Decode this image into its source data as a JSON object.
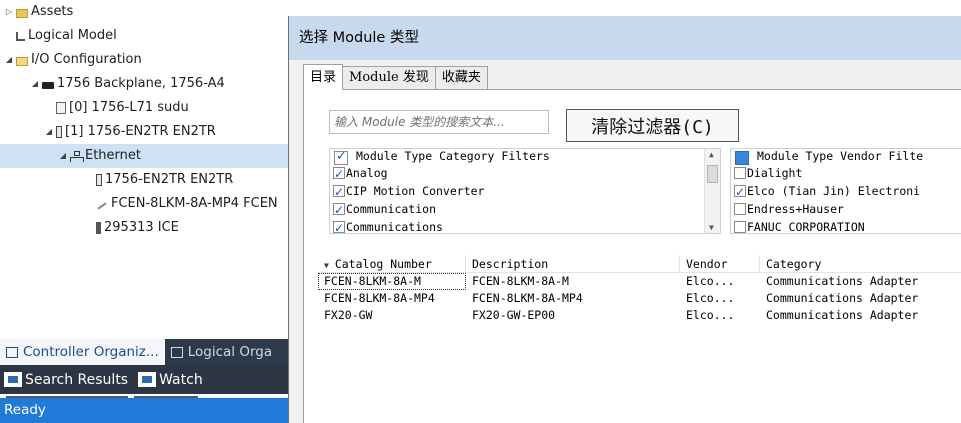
{
  "organizer": {
    "tree": [
      {
        "label": "Assets",
        "icon": "folder-icon",
        "expand": "▷",
        "indent": 1
      },
      {
        "label": "Logical Model",
        "icon": "logical-model-icon",
        "expand": "",
        "indent": 1
      },
      {
        "label": "I/O Configuration",
        "icon": "folder-open-icon",
        "expand": "◢",
        "indent": 1
      },
      {
        "label": "1756 Backplane, 1756-A4",
        "icon": "backplane-icon",
        "expand": "◢",
        "indent": 2
      },
      {
        "label": "[0] 1756-L71 sudu",
        "icon": "controller-icon",
        "expand": "",
        "indent": 3
      },
      {
        "label": "[1] 1756-EN2TR EN2TR",
        "icon": "module-icon",
        "expand": "◢",
        "indent": 3
      },
      {
        "label": "Ethernet",
        "icon": "ethernet-icon",
        "expand": "◢",
        "indent": 4,
        "selected": true
      },
      {
        "label": "1756-EN2TR EN2TR",
        "icon": "module-icon",
        "expand": "",
        "indent": 5
      },
      {
        "label": "FCEN-8LKM-8A-MP4 FCEN",
        "icon": "cable-icon",
        "expand": "",
        "indent": 5
      },
      {
        "label": "295313 ICE",
        "icon": "device-icon",
        "expand": "",
        "indent": 5
      }
    ],
    "tabs": [
      "Controller Organiz...",
      "Logical Orga"
    ],
    "bottom_buttons": [
      "Search Results",
      "Watch"
    ],
    "status": "Ready"
  },
  "dialog": {
    "title": "选择 Module 类型",
    "tabs": [
      "目录",
      "Module 发现",
      "收藏夹"
    ],
    "search_placeholder": "输入 Module 类型的搜索文本...",
    "clear_filter_label": "清除过滤器(C)",
    "category_filters": {
      "header": "Module Type Category Filters",
      "items": [
        {
          "label": "Analog",
          "checked": true
        },
        {
          "label": "CIP Motion Converter",
          "checked": true
        },
        {
          "label": "Communication",
          "checked": true
        },
        {
          "label": "Communications",
          "checked": true
        }
      ]
    },
    "vendor_filters": {
      "header": "Module Type Vendor Filte",
      "items": [
        {
          "label": "Dialight",
          "checked": false
        },
        {
          "label": "Elco (Tian Jin) Electroni",
          "checked": true
        },
        {
          "label": "Endress+Hauser",
          "checked": false
        },
        {
          "label": "FANUC CORPORATION",
          "checked": false
        }
      ]
    },
    "table": {
      "columns": [
        "Catalog Number",
        "Description",
        "Vendor",
        "Category"
      ],
      "rows": [
        [
          "FCEN-8LKM-8A-M",
          "FCEN-8LKM-8A-M",
          "Elco...",
          "Communications Adapter"
        ],
        [
          "FCEN-8LKM-8A-MP4",
          "FCEN-8LKM-8A-MP4",
          "Elco...",
          "Communications Adapter"
        ],
        [
          "FX20-GW",
          "FX20-GW-EP00",
          "Elco...",
          "Communications Adapter"
        ]
      ]
    }
  },
  "colors": {
    "selection": "#cfe1f5",
    "status_bar": "#1f7ad8",
    "dialog_title": "#c7d9ec",
    "dark_panel": "#2b3544"
  }
}
